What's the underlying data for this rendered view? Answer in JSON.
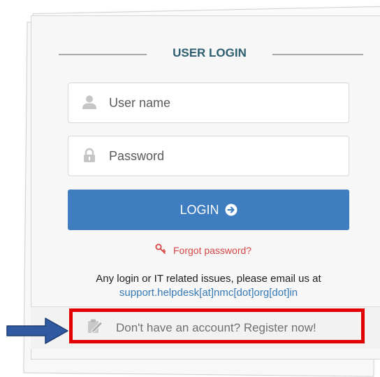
{
  "login": {
    "title": "USER LOGIN",
    "username": {
      "placeholder": "User name",
      "value": ""
    },
    "password": {
      "placeholder": "Password",
      "value": ""
    },
    "login_button_label": "LOGIN",
    "forgot_password_label": "Forgot password?",
    "help_text": "Any login or IT related issues, please email us at",
    "support_email": "support.helpdesk[at]nmc[dot]org[dot]in",
    "register_label": "Don't have an account? Register now!"
  },
  "colors": {
    "title": "#2d5f70",
    "login_button": "#3d7dc0",
    "forgot_link": "#d64545",
    "email_link": "#3679b5",
    "highlight_box": "#e30000",
    "pointer_arrow": "#2f5aa2"
  },
  "icons": {
    "username": "user-icon",
    "password": "lock-icon",
    "login": "arrow-right-circle-icon",
    "forgot": "key-icon",
    "register": "clipboard-edit-icon",
    "pointer": "arrow-right-icon"
  }
}
